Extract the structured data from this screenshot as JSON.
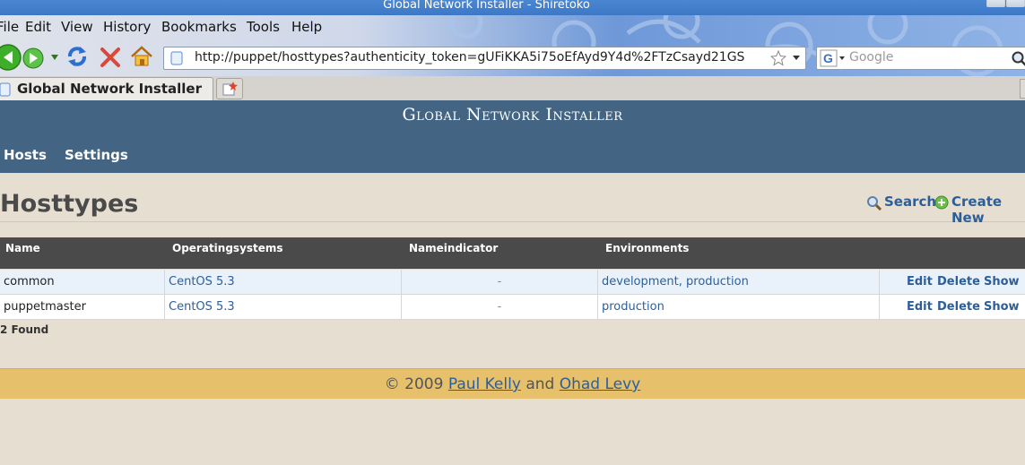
{
  "window": {
    "title": "Global Network Installer - Shiretoko"
  },
  "menubar": [
    {
      "label": "File"
    },
    {
      "label": "Edit"
    },
    {
      "label": "View"
    },
    {
      "label": "History"
    },
    {
      "label": "Bookmarks"
    },
    {
      "label": "Tools"
    },
    {
      "label": "Help"
    }
  ],
  "toolbar": {
    "url": "http://puppet/hosttypes?authenticity_token=gUFiKKA5i75oEfAyd9Y4d%2FTzCsayd21GS",
    "search_placeholder": "Google",
    "icons": [
      "back-icon",
      "forward-icon",
      "history-dropdown-icon",
      "reload-icon",
      "stop-icon",
      "home-icon",
      "page-icon",
      "star-icon",
      "google-icon",
      "search-icon"
    ]
  },
  "tabs": [
    {
      "label": "Global Network Installer",
      "active": true
    }
  ],
  "site": {
    "title": "Global Network Installer",
    "nav": [
      {
        "label": "Hosts"
      },
      {
        "label": "Settings"
      }
    ]
  },
  "page": {
    "title": "Hosttypes",
    "actions": {
      "search": "Search",
      "create": "Create New"
    },
    "columns": [
      "Name",
      "Operatingsystems",
      "Nameindicator",
      "Environments"
    ],
    "rows": [
      {
        "name": "common",
        "os": "CentOS 5.3",
        "nameindicator": "-",
        "environments": "development, production"
      },
      {
        "name": "puppetmaster",
        "os": "CentOS 5.3",
        "nameindicator": "-",
        "environments": "production"
      }
    ],
    "row_actions": {
      "edit": "Edit",
      "delete": "Delete",
      "show": "Show"
    },
    "found": "2 Found"
  },
  "footer": {
    "prefix": "© 2009",
    "author1": "Paul Kelly",
    "and": "and",
    "author2": "Ohad Levy"
  },
  "colors": {
    "header": "#436583",
    "footer": "#e6c06b",
    "link": "#2c5f9a",
    "table_head": "#4a4a4a",
    "page_bg": "#e6dfd1"
  }
}
